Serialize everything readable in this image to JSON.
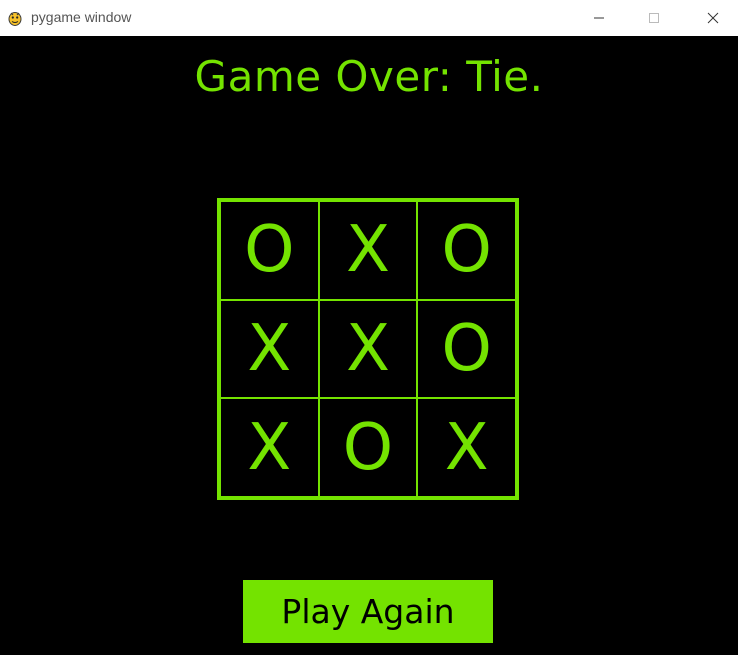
{
  "window": {
    "title": "pygame window",
    "app_icon": "pygame-snake-icon",
    "controls": {
      "minimize": "minimize-icon",
      "maximize": "maximize-icon",
      "close": "close-icon"
    }
  },
  "game": {
    "status": "Game Over: Tie.",
    "board": [
      [
        "O",
        "X",
        "O"
      ],
      [
        "X",
        "X",
        "O"
      ],
      [
        "X",
        "O",
        "X"
      ]
    ],
    "play_again_label": "Play Again",
    "colors": {
      "accent": "#74e300",
      "background": "#000000",
      "button_text": "#000000"
    }
  }
}
